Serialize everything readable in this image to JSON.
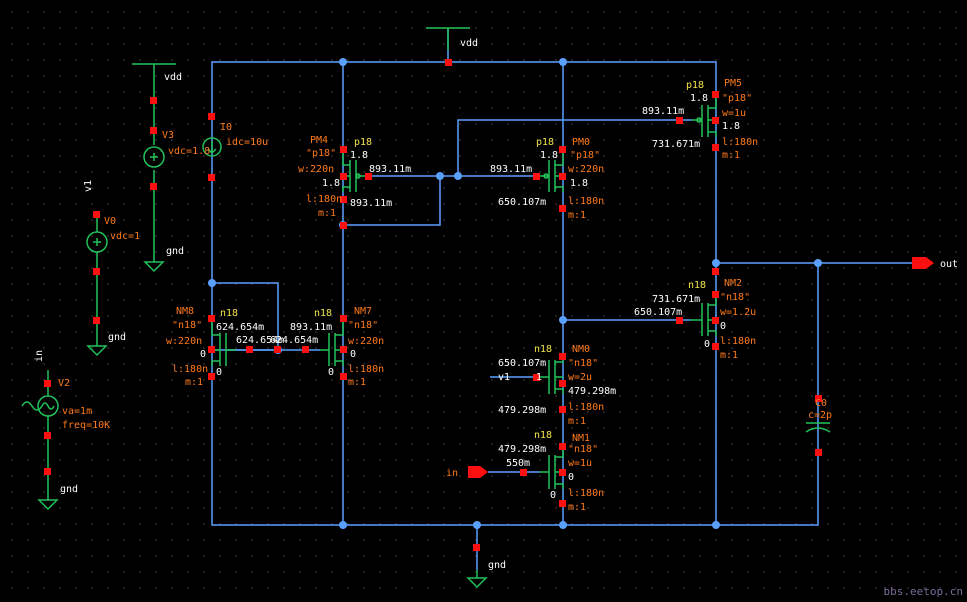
{
  "colors": {
    "wire": "#5aa0ff",
    "symbol": "#22c25a",
    "pin": "#ff1010",
    "param": "#ff7a1a",
    "label": "#f2e34a",
    "background": "#000000"
  },
  "nets": {
    "vdd_top": "vdd",
    "vdd_v3": "vdd",
    "v1": "v1",
    "gnd_v3": "gnd",
    "gnd_v0": "gnd",
    "in": "in",
    "gnd_v2": "gnd",
    "gnd_bottom": "gnd",
    "out": "out",
    "v1_in": "v1",
    "in_pin": "in"
  },
  "sources": {
    "v3": {
      "name": "V3",
      "param": "vdc=1.8"
    },
    "v0": {
      "name": "V0",
      "param": "vdc=1"
    },
    "v2": {
      "name": "V2",
      "param1": "va=1m",
      "param2": "freq=10K"
    },
    "i0": {
      "name": "I0",
      "param": "idc=10u"
    },
    "c0": {
      "name": "C0",
      "param": "c=2p"
    }
  },
  "devices": {
    "pm4": {
      "name": "PM4",
      "model": "p18",
      "cell": "\"p18\"",
      "w": "w:220n",
      "l": "l:180n",
      "m": "m:1",
      "d": "1.8",
      "s": "1.8",
      "g": "893.11m",
      "x": "893.11m"
    },
    "pm0": {
      "name": "PM0",
      "model": "p18",
      "cell": "\"p18\"",
      "w": "w:220n",
      "l": "l:180n",
      "m": "m:1",
      "d": "1.8",
      "s": "1.8",
      "g": "893.11m",
      "x": "650.107m"
    },
    "pm5": {
      "name": "PM5",
      "model": "p18",
      "cell": "\"p18\"",
      "w": "w=1u",
      "l": "l:180n",
      "m": "m:1",
      "d": "1.8",
      "s": "1.8",
      "g": "893.11m",
      "x": "731.671m"
    },
    "nm8": {
      "name": "NM8",
      "model": "n18",
      "cell": "\"n18\"",
      "w": "w:220n",
      "l": "l:180n",
      "m": "m:1",
      "g": "624.654m",
      "g2": "624.654m",
      "b": "0",
      "s": "0"
    },
    "nm7": {
      "name": "NM7",
      "model": "n18",
      "cell": "\"n18\"",
      "w": "w:220n",
      "l": "l:180n",
      "m": "m:1",
      "g": "893.11m",
      "g2": "624.654m",
      "b": "0",
      "s": "0"
    },
    "nm2": {
      "name": "NM2",
      "model": "n18",
      "cell": "\"n18\"",
      "w": "w=1.2u",
      "l": "l:180n",
      "m": "m:1",
      "d": "731.671m",
      "g": "650.107m",
      "b": "0",
      "s": "0"
    },
    "nm0": {
      "name": "NM0",
      "model": "n18",
      "cell": "\"n18\"",
      "w": "w=2u",
      "l": "l:180n",
      "m": "m:1",
      "d": "650.107m",
      "g": "1",
      "s": "479.298m",
      "x": "479.298m"
    },
    "nm1": {
      "name": "NM1",
      "model": "n18",
      "cell": "\"n18\"",
      "w": "w=1u",
      "l": "l:180n",
      "m": "m:1",
      "d": "479.298m",
      "g": "550m",
      "s": "0",
      "b": "0"
    }
  },
  "watermark": "bbs.eetop.cn"
}
